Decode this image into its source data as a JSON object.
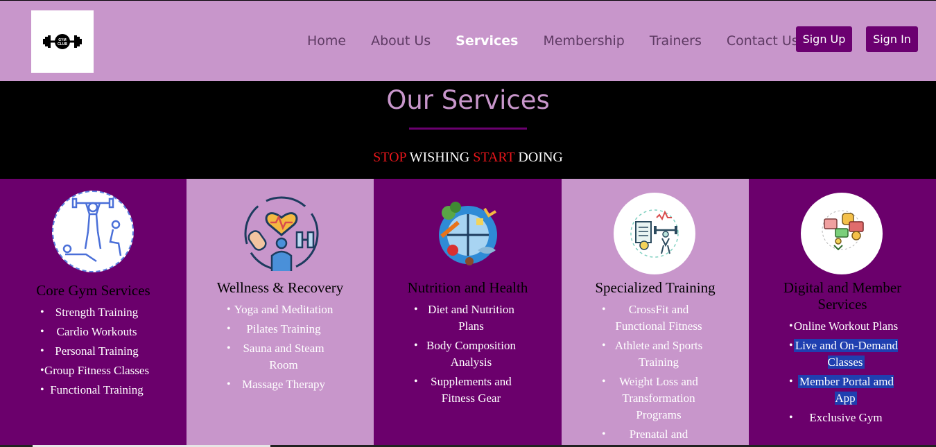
{
  "header": {
    "logo_text": "GYM CLUB",
    "nav": [
      "Home",
      "About Us",
      "Services",
      "Membership",
      "Trainers",
      "Contact Us"
    ],
    "active_nav": "Services",
    "signup_label": "Sign Up",
    "signin_label": "Sign In"
  },
  "hero": {
    "title": "Our Services",
    "slogan": [
      "STOP",
      "WISHING",
      "START",
      "DOING"
    ]
  },
  "colors": {
    "header_bg": "#c896cb",
    "accent_dark": "#6b006c",
    "button_bg": "#6b0070",
    "slogan_red": "#e8161b",
    "highlight": "#1f3fb0"
  },
  "services": [
    {
      "icon": "gym-workout-icon",
      "heading": "Core Gym Services",
      "items": [
        "Strength Training",
        "Cardio Workouts",
        "Personal Training",
        "Group Fitness Classes",
        "Functional Training"
      ]
    },
    {
      "icon": "wellness-recovery-icon",
      "heading": "Wellness & Recovery",
      "items": [
        "Yoga and Meditation",
        "Pilates Training",
        "Sauna and Steam Room",
        "Massage Therapy"
      ]
    },
    {
      "icon": "nutrition-plate-icon",
      "heading": "Nutrition and Health",
      "items": [
        "Diet and Nutrition Plans",
        "Body Composition Analysis",
        "Supplements and Fitness Gear"
      ]
    },
    {
      "icon": "specialized-training-icon",
      "heading": "Specialized Training",
      "items": [
        "CrossFit and Functional Fitness",
        "Athlete and Sports Training",
        "Weight Loss and Transformation Programs",
        "Prenatal and"
      ]
    },
    {
      "icon": "digital-member-icon",
      "heading": "Digital and Member Services",
      "items": [
        "Online Workout Plans",
        "Live and On-Demand Classes",
        "Member Portal amd App",
        "Exclusive Gym"
      ]
    }
  ]
}
